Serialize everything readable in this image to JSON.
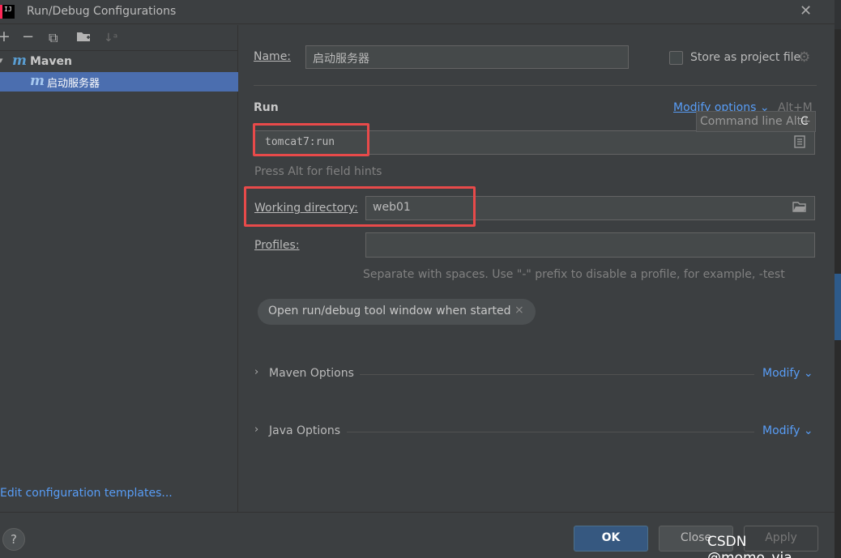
{
  "window": {
    "title": "Run/Debug Configurations",
    "app_icon_text": "IJ",
    "close_icon": "close-icon"
  },
  "sidebar": {
    "toolbar": {
      "add": "+",
      "remove": "−",
      "copy": "⧉",
      "new_folder": "▰",
      "sort": "↓ᵃ"
    },
    "tree": {
      "group_label": "Maven",
      "group_logo": "m",
      "selected_item": "启动服务器",
      "item_logo": "m"
    },
    "edit_templates_link": "Edit configuration templates..."
  },
  "main": {
    "name_label": "Name:",
    "name_value": "启动服务器",
    "store_label": "Store as project file",
    "run_heading": "Run",
    "modify_options_link": "Modify options",
    "modify_options_shortcut": "Alt+M",
    "tooltip_text": "Command line Alt+",
    "tooltip_key": "C",
    "command_value": "tomcat7:run",
    "field_hint": "Press Alt for field hints",
    "working_dir_label": "Working directory:",
    "working_dir_value": "web01",
    "profiles_label": "Profiles:",
    "profiles_value": "",
    "profiles_hint": "Separate with spaces. Use \"-\" prefix to disable a profile, for example, -test",
    "chip_label": "Open run/debug tool window when started",
    "chip_close": "×",
    "sections": [
      {
        "label": "Maven Options",
        "modify": "Modify"
      },
      {
        "label": "Java Options",
        "modify": "Modify"
      }
    ]
  },
  "footer": {
    "help": "?",
    "ok": "OK",
    "close": "Close",
    "apply": "Apply",
    "watermark": "CSDN @momo_via"
  },
  "colors": {
    "accent_link": "#589df6",
    "selection": "#4b6eaf",
    "highlight_box": "#e84a4a"
  }
}
